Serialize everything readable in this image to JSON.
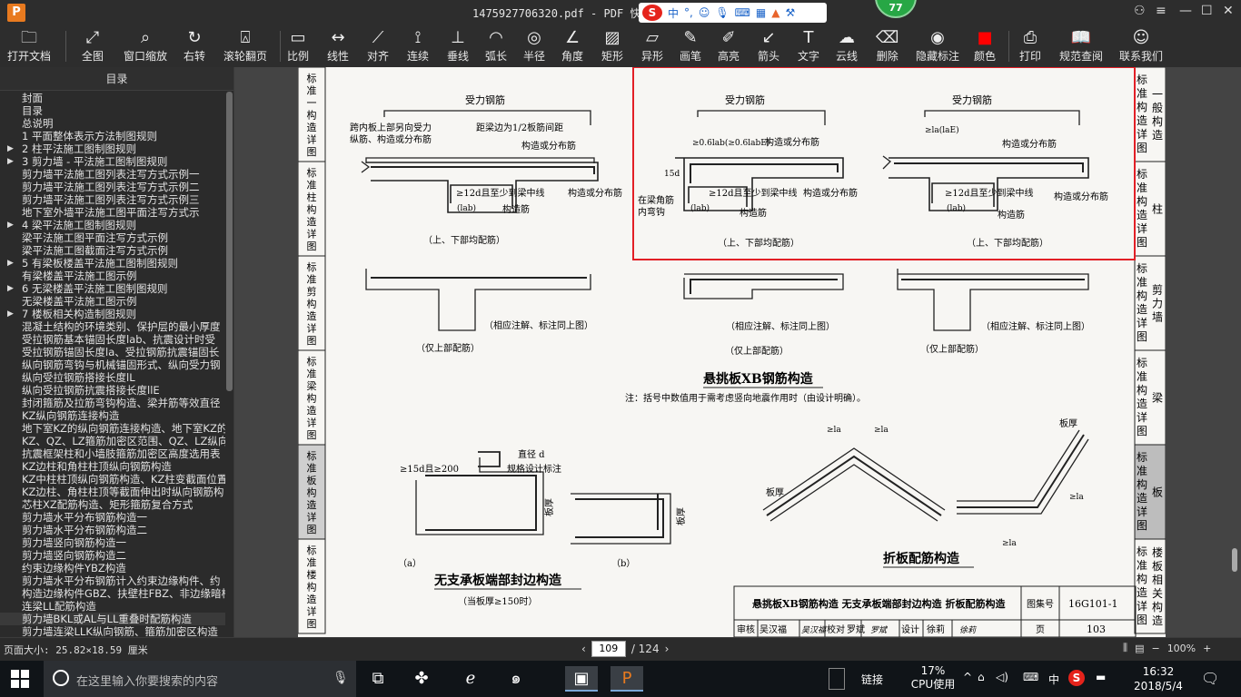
{
  "window": {
    "logo": "P",
    "title": "1475927706320.pdf - PDF 快速看",
    "ime": {
      "lang": "中",
      "punct": "°,",
      "badge": "77"
    }
  },
  "toolbar": [
    {
      "id": "open",
      "icon": "folder-icon",
      "glyph": "🗀",
      "label": "打开文档"
    },
    {
      "id": "fit",
      "icon": "expand-icon",
      "glyph": "⤢",
      "label": "全图"
    },
    {
      "id": "winzoom",
      "icon": "magnifier-icon",
      "glyph": "⌕",
      "label": "窗口缩放"
    },
    {
      "id": "rotate",
      "icon": "rotate-icon",
      "glyph": "↻",
      "label": "右转"
    },
    {
      "id": "scroll",
      "icon": "mouse-icon",
      "glyph": "⍓",
      "label": "滚轮翻页"
    },
    {
      "id": "scale",
      "icon": "ruler-icon",
      "glyph": "▭",
      "label": "比例"
    },
    {
      "id": "linear",
      "icon": "linear-dim-icon",
      "glyph": "↔",
      "label": "线性"
    },
    {
      "id": "align",
      "icon": "aligned-dim-icon",
      "glyph": "⟋",
      "label": "对齐"
    },
    {
      "id": "continuous",
      "icon": "continuous-dim-icon",
      "glyph": "⟟",
      "label": "连续"
    },
    {
      "id": "perp",
      "icon": "perpendicular-icon",
      "glyph": "⊥",
      "label": "垂线"
    },
    {
      "id": "arc",
      "icon": "arc-length-icon",
      "glyph": "◠",
      "label": "弧长"
    },
    {
      "id": "radius",
      "icon": "radius-icon",
      "glyph": "◎",
      "label": "半径"
    },
    {
      "id": "angle",
      "icon": "angle-icon",
      "glyph": "∠",
      "label": "角度"
    },
    {
      "id": "rect",
      "icon": "rectangle-icon",
      "glyph": "▨",
      "label": "矩形"
    },
    {
      "id": "shape",
      "icon": "irregular-shape-icon",
      "glyph": "▱",
      "label": "异形"
    },
    {
      "id": "pen",
      "icon": "pencil-icon",
      "glyph": "✎",
      "label": "画笔"
    },
    {
      "id": "highlight",
      "icon": "highlighter-icon",
      "glyph": "✐",
      "label": "高亮"
    },
    {
      "id": "arrow",
      "icon": "arrow-icon",
      "glyph": "↙",
      "label": "箭头"
    },
    {
      "id": "text",
      "icon": "text-icon",
      "glyph": "T",
      "label": "文字"
    },
    {
      "id": "cloud",
      "icon": "cloud-line-icon",
      "glyph": "☁",
      "label": "云线"
    },
    {
      "id": "erase",
      "icon": "eraser-icon",
      "glyph": "⌫",
      "label": "删除"
    },
    {
      "id": "hide",
      "icon": "eye-off-icon",
      "glyph": "◉",
      "label": "隐藏标注"
    },
    {
      "id": "color",
      "icon": "color-swatch-icon",
      "glyph": "■",
      "label": "颜色"
    },
    {
      "id": "print",
      "icon": "printer-icon",
      "glyph": "⎙",
      "label": "打印"
    },
    {
      "id": "spec",
      "icon": "book-icon",
      "glyph": "📖",
      "label": "规范查阅"
    },
    {
      "id": "contact",
      "icon": "contact-icon",
      "glyph": "☺",
      "label": "联系我们"
    }
  ],
  "accent": {
    "swatch": "#ff0000",
    "highlight_box": "#e21f26"
  },
  "sidebar": {
    "title": "目录",
    "items": [
      {
        "label": "封面",
        "arrow": false
      },
      {
        "label": "目录",
        "arrow": false
      },
      {
        "label": "总说明",
        "arrow": false
      },
      {
        "label": "1 平面整体表示方法制图规则",
        "arrow": false
      },
      {
        "label": "2 柱平法施工图制图规则",
        "arrow": true
      },
      {
        "label": "3 剪力墙 - 平法施工图制图规则",
        "arrow": true
      },
      {
        "label": "剪力墙平法施工图列表注写方式示例一",
        "arrow": false
      },
      {
        "label": "剪力墙平法施工图列表注写方式示例二",
        "arrow": false
      },
      {
        "label": "剪力墙平法施工图列表注写方式示例三",
        "arrow": false
      },
      {
        "label": "地下室外墙平法施工图平面注写方式示",
        "arrow": false
      },
      {
        "label": "4 梁平法施工图制图规则",
        "arrow": true
      },
      {
        "label": "梁平法施工图平面注写方式示例",
        "arrow": false
      },
      {
        "label": "梁平法施工图截面注写方式示例",
        "arrow": false
      },
      {
        "label": "5 有梁板楼盖平法施工图制图规则",
        "arrow": true
      },
      {
        "label": "有梁楼盖平法施工图示例",
        "arrow": false
      },
      {
        "label": "6 无梁楼盖平法施工图制图规则",
        "arrow": true
      },
      {
        "label": "无梁楼盖平法施工图示例",
        "arrow": false
      },
      {
        "label": "7 楼板相关构造制图规则",
        "arrow": true
      },
      {
        "label": "混凝土结构的环境类别、保护层的最小厚度",
        "arrow": false
      },
      {
        "label": "受拉钢筋基本锚固长度lab、抗震设计时受",
        "arrow": false
      },
      {
        "label": "受拉钢筋锚固长度la、受拉钢筋抗震锚固长",
        "arrow": false
      },
      {
        "label": "纵向钢筋弯钩与机械锚固形式、纵向受力钢",
        "arrow": false
      },
      {
        "label": "纵向受拉钢筋搭接长度lL",
        "arrow": false
      },
      {
        "label": "纵向受拉钢筋抗震搭接长度llE",
        "arrow": false
      },
      {
        "label": "封闭箍筋及拉筋弯钩构造、梁并筋等效直径",
        "arrow": false
      },
      {
        "label": "KZ纵向钢筋连接构造",
        "arrow": false
      },
      {
        "label": "地下室KZ的纵向钢筋连接构造、地下室KZ的",
        "arrow": false
      },
      {
        "label": "KZ、QZ、LZ箍筋加密区范围、QZ、LZ纵向钢",
        "arrow": false
      },
      {
        "label": "抗震框架柱和小墙肢箍筋加密区高度选用表",
        "arrow": false
      },
      {
        "label": "KZ边柱和角柱柱顶纵向钢筋构造",
        "arrow": false
      },
      {
        "label": "KZ中柱柱顶纵向钢筋构造、KZ柱变截面位置",
        "arrow": false
      },
      {
        "label": "KZ边柱、角柱柱顶等截面伸出时纵向钢筋构",
        "arrow": false
      },
      {
        "label": "芯柱XZ配筋构造、矩形箍筋复合方式",
        "arrow": false
      },
      {
        "label": "剪力墙水平分布钢筋构造一",
        "arrow": false
      },
      {
        "label": "剪力墙水平分布钢筋构造二",
        "arrow": false
      },
      {
        "label": "剪力墙竖向钢筋构造一",
        "arrow": false
      },
      {
        "label": "剪力墙竖向钢筋构造二",
        "arrow": false
      },
      {
        "label": "约束边缘构件YBZ构造",
        "arrow": false
      },
      {
        "label": "剪力墙水平分布钢筋计入约束边缘构件、约",
        "arrow": false
      },
      {
        "label": "构造边缘构件GBZ、扶壁柱FBZ、非边缘暗柱",
        "arrow": false
      },
      {
        "label": "连梁LL配筋构造",
        "arrow": false
      },
      {
        "label": "剪力墙BKL或AL与LL重叠时配筋构造",
        "arrow": false
      },
      {
        "label": "剪力墙连梁LLK纵向钢筋、箍筋加密区构造",
        "arrow": false
      }
    ],
    "selected_index": 41
  },
  "document": {
    "left_tabs": [
      "标准构造详图",
      "标准构造详图",
      "标准构造详图",
      "标准构造详图",
      "标准构造详图",
      "标准构造详图"
    ],
    "left_tabs_short": [
      "一般构造详图",
      "柱",
      "剪力墙",
      "梁",
      "板",
      "楼板相关构造"
    ],
    "right_tabs": [
      {
        "label": "一般构造",
        "top": "标准构造详图"
      },
      {
        "label": "柱",
        "top": "标准构造详图"
      },
      {
        "label": "剪力墙",
        "top": "标准构造详图"
      },
      {
        "label": "梁",
        "top": "标准构造详图"
      },
      {
        "label": "板",
        "top": "标准构造详图"
      },
      {
        "label": "楼板相关构造",
        "top": "标准构造详图"
      }
    ],
    "labels": {
      "main_rebar": "受力钢筋",
      "span_rebar_note_1": "跨内板上部另向受力",
      "span_rebar_note_2": "纵筋、构造或分布筋",
      "edge_dist": "距梁边为1/2板筋间距",
      "dist_rebar": "构造或分布筋",
      "to_center": "≥12d且至少到梁中线",
      "lab": "(lab)",
      "top_bottom": "（上、下部均配筋）",
      "hook_15d": "15d",
      "anchor_06": "≥0.6lab(≥0.6labE)",
      "in_beam_hook_1": "在梁角筋",
      "in_beam_hook_2": "内弯钩",
      "construct_rebar": "构造筋",
      "la_lae": "≥la(laE)",
      "same_note": "（相应注解、标注同上图）",
      "top_only": "（仅上部配筋）",
      "cantilever_title": "悬挑板XB钢筋构造",
      "note": "注：括号中数值用于需考虑竖向地震作用时（由设计明确）。",
      "dia_d": "直径 d",
      "spec_note": "规格设计标注",
      "ge15d": "≥15d且≥200",
      "slab_thk": "板厚",
      "fig_a": "（a）",
      "fig_b": "（b）",
      "edge_title": "无支承板端部封边构造",
      "edge_sub": "（当板厚≥150时）",
      "la": "≥la",
      "folded_title": "折板配筋构造"
    },
    "titleblock": {
      "title": "悬挑板XB钢筋构造  无支承板端部封边构造  折板配筋构造",
      "atlas_label": "图集号",
      "atlas_no": "16G101-1",
      "review": "审核",
      "reviewer": "吴汉福",
      "reviewer_sig": "吴汉福",
      "check": "校对",
      "checker": "罗斌",
      "checker_sig": "罗斌",
      "design": "设计",
      "designer": "徐莉",
      "designer_sig": "徐莉",
      "page_label": "页",
      "page_no": "103"
    }
  },
  "status": {
    "page_size": "页面大小: 25.82×18.59 厘米",
    "current_page": "109",
    "total_pages": "/ 124",
    "zoom": "100%"
  },
  "taskbar": {
    "search_placeholder": "在这里输入你要搜索的内容",
    "tray_link": "链接",
    "cpu_pct": "17%",
    "cpu_label": "CPU使用",
    "ime": "中",
    "time": "16:32",
    "date": "2018/5/4"
  }
}
